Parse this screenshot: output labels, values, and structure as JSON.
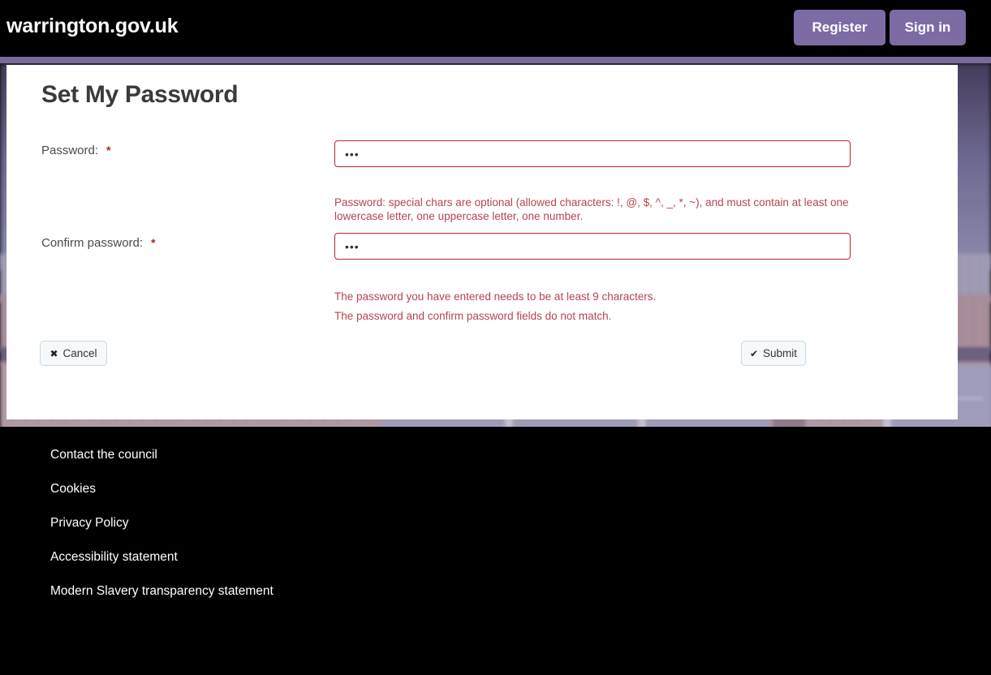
{
  "header": {
    "brand": "warrington.gov.uk",
    "register_label": "Register",
    "signin_label": "Sign in",
    "button_color": "#7d6ba4",
    "background_color": "#000000",
    "rule_color": "#7a6a9e"
  },
  "card": {
    "title": "Set My Password",
    "fields": [
      {
        "label": "Password:",
        "required_marker": "*",
        "value": "•••",
        "placeholder": ""
      },
      {
        "label": "Confirm password:",
        "required_marker": "*",
        "value": "•••",
        "placeholder": ""
      }
    ],
    "password_hint": "Password: special chars are optional (allowed characters: !, @, $, ^, _, *, ~), and must contain at least one lowercase letter, one uppercase letter, one number.",
    "errors": [
      "The password you have entered needs to be at least 9 characters.",
      "The password and confirm password fields do not match."
    ],
    "error_color": "#b4454f",
    "input_border_color": "#b02a2a",
    "buttons": {
      "cancel_label": "Cancel",
      "cancel_glyph": "✖",
      "submit_label": "Submit",
      "submit_glyph": "✔"
    }
  },
  "footer": {
    "links": [
      "Contact the council",
      "Cookies",
      "Privacy Policy",
      "Accessibility statement",
      "Modern Slavery transparency statement"
    ],
    "background_color": "#000000"
  }
}
